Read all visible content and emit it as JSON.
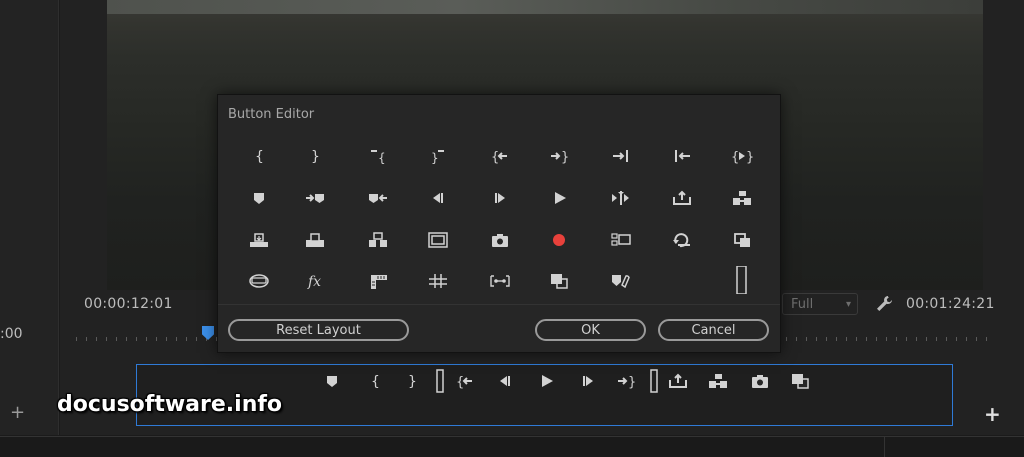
{
  "left": {
    "timecode": ":00",
    "add_icon": "plus-icon"
  },
  "monitor": {
    "timecode_current": "00:00:12:01",
    "timecode_duration": "00:01:24:21",
    "fit_value": "Full"
  },
  "dialog": {
    "title": "Button Editor",
    "reset_label": "Reset Layout",
    "ok_label": "OK",
    "cancel_label": "Cancel",
    "buttons": [
      [
        "mark-in",
        "mark-out",
        "clear-in",
        "clear-out",
        "go-to-in",
        "go-to-out",
        "go-to-next-edit",
        "go-to-previous-edit",
        "play-in-to-out"
      ],
      [
        "add-marker",
        "go-to-next-marker",
        "go-to-previous-marker",
        "step-back",
        "step-forward",
        "play-stop",
        "play-around",
        "lift",
        "extract"
      ],
      [
        "insert",
        "overwrite",
        "export-frame-alt",
        "safe-margins",
        "export-frame",
        "record",
        "multi-camera",
        "loop",
        "toggle-proxies"
      ],
      [
        "vr-video",
        "global-fx-mute",
        "show-rulers",
        "show-guides",
        "snap-in-program",
        "comparison-view",
        "toggle-lumetri",
        "",
        "spacer"
      ]
    ],
    "record_color": "#e8413b"
  },
  "transport": {
    "buttons": [
      "add-marker",
      "mark-in",
      "mark-out",
      "spacer",
      "go-to-in",
      "step-back",
      "play-stop",
      "step-forward",
      "go-to-out",
      "spacer",
      "lift",
      "extract",
      "export-frame",
      "comparison-view"
    ],
    "add_icon": "plus-icon"
  },
  "watermark": "docusoftware.info",
  "colors": {
    "accent": "#2f7ad6",
    "playhead": "#3b8ee8"
  }
}
